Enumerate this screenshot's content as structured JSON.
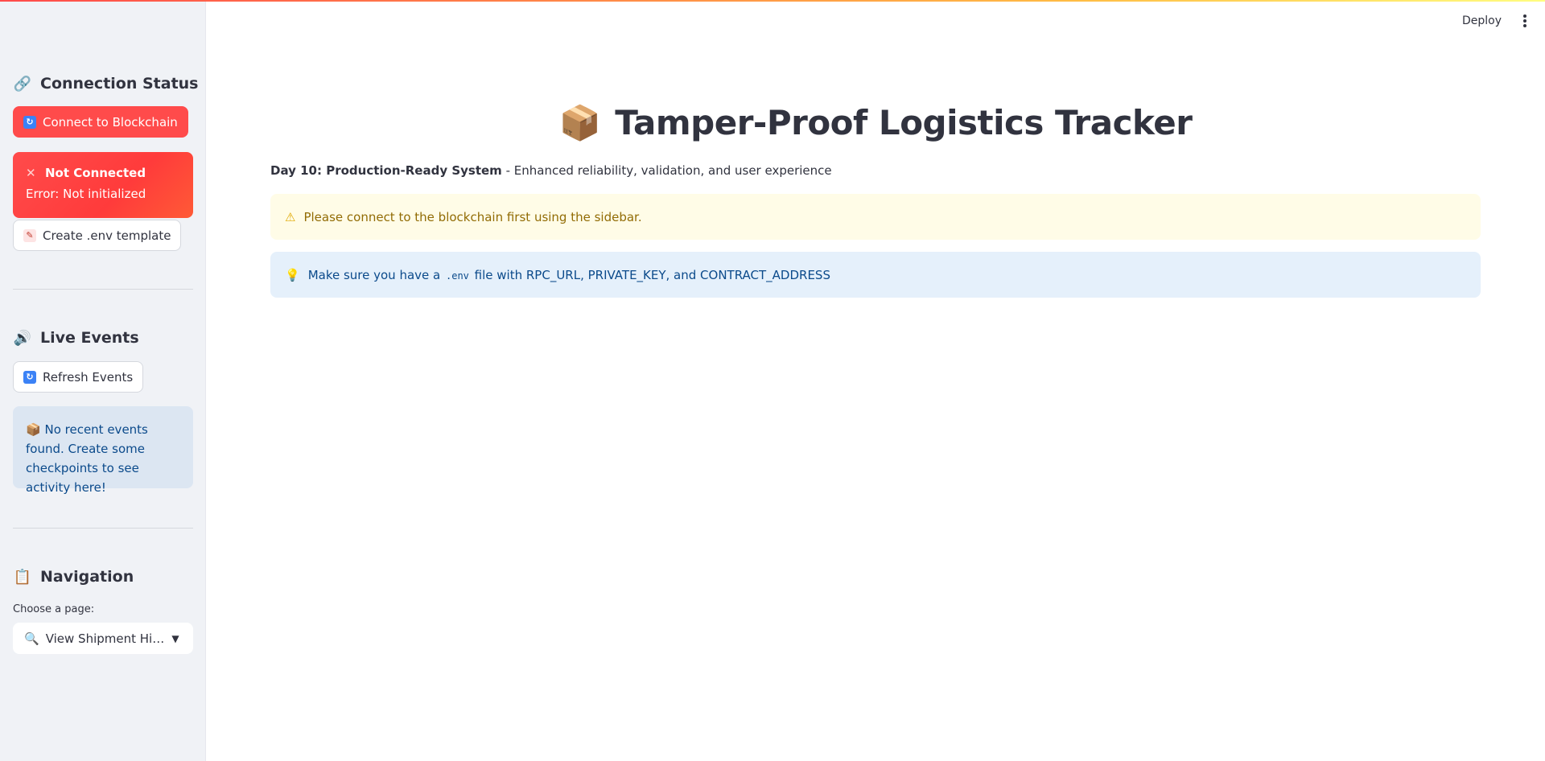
{
  "sidebar": {
    "connection": {
      "heading_icon": "🔗",
      "heading": "Connection Status",
      "connect_button_icon": "🔄",
      "connect_button": "Connect to Blockchain",
      "error_title": "Not Connected",
      "error_message": "Error: Not initialized",
      "env_button_icon": "📝",
      "env_button": "Create .env template"
    },
    "events": {
      "heading_icon": "🔊",
      "heading": "Live Events",
      "refresh_button_icon": "🔄",
      "refresh_button": "Refresh Events",
      "empty_icon": "📦",
      "empty_message": "No recent events found. Create some checkpoints to see activity here!"
    },
    "navigation": {
      "heading_icon": "📋",
      "heading": "Navigation",
      "select_label": "Choose a page:",
      "selected_icon": "🔍",
      "selected_value": "View Shipment History"
    }
  },
  "header": {
    "deploy_label": "Deploy"
  },
  "main": {
    "title_icon": "📦",
    "title": "Tamper-Proof Logistics Tracker",
    "subtitle_bold": "Day 10: Production-Ready System",
    "subtitle_rest": " - Enhanced reliability, validation, and user experience",
    "warning_text": "Please connect to the blockchain first using the sidebar.",
    "info_prefix": "Make sure you have a ",
    "info_code": ".env",
    "info_suffix": " file with RPC_URL, PRIVATE_KEY, and CONTRACT_ADDRESS"
  },
  "colors": {
    "primary": "#ff4b4b",
    "sidebar_bg": "#f0f2f6",
    "warning_bg": "#fffce7",
    "info_bg": "#e5f0fb"
  },
  "icons": [
    "link-icon",
    "refresh-icon",
    "x-icon",
    "memo-icon",
    "speaker-icon",
    "package-icon",
    "clipboard-icon",
    "search-icon",
    "chevron-down-icon",
    "kebab-menu-icon",
    "warning-icon",
    "lightbulb-icon"
  ]
}
